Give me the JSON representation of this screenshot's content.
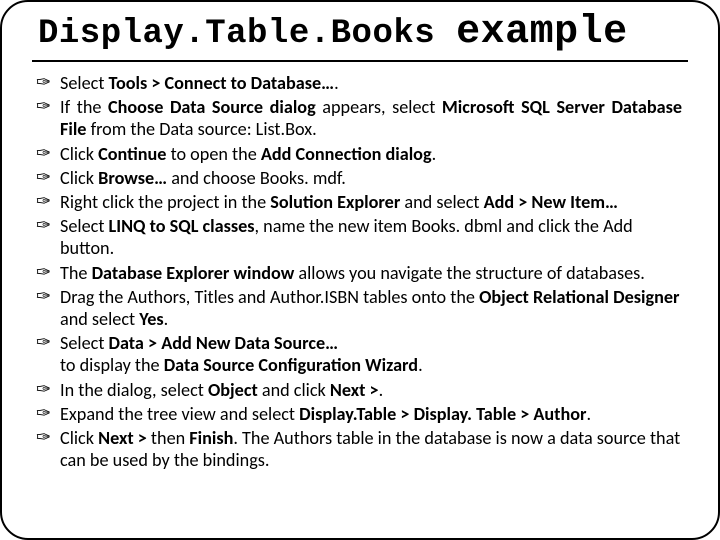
{
  "title": {
    "word1": "Display.Table.Books",
    "word2": "example"
  },
  "bullets": [
    {
      "html": "Select <span class='b'>Tools &gt; Connect to Database…</span>."
    },
    {
      "html": "If the <span class='b'>Choose Data Source dialog</span> appears, select <span class='b'>Microsoft SQL Server Database File</span> from the Data source: List.Box.",
      "justify": true
    },
    {
      "html": "Click <span class='b'>Continue</span> to open the <span class='b'>Add Connection dialog</span>."
    },
    {
      "html": "Click <span class='b'>Browse…</span> and choose Books. mdf."
    },
    {
      "html": "Right click the project in the <span class='b'>Solution Explorer</span> and select <span class='b'>Add &gt; New Item…</span>"
    },
    {
      "html": "Select <span class='b'>LINQ to SQL classes</span>, name the new item Books. dbml and click the Add button."
    },
    {
      "html": "The <span class='b'>Database Explorer window</span> allows you navigate the structure of databases."
    },
    {
      "html": "Drag the Authors, Titles and Author.ISBN tables onto the <span class='b'>Object Relational Designer</span> and select <span class='b'>Yes</span>."
    },
    {
      "html": "Select <span class='b'>Data &gt; Add New Data Source…</span><br>to display the <span class='b'>Data Source Configuration Wizard</span>."
    },
    {
      "html": "In the dialog, select <span class='b'>Object</span> and click <span class='b'>Next &gt;</span>."
    },
    {
      "html": "Expand the tree view and select <span class='b'>Display.Table &gt; Display. Table &gt; Author</span>."
    },
    {
      "html": "Click <span class='b'>Next &gt;</span> then <span class='b'>Finish</span>. The Authors table in the database is now a data source that can be used by the bindings."
    }
  ]
}
